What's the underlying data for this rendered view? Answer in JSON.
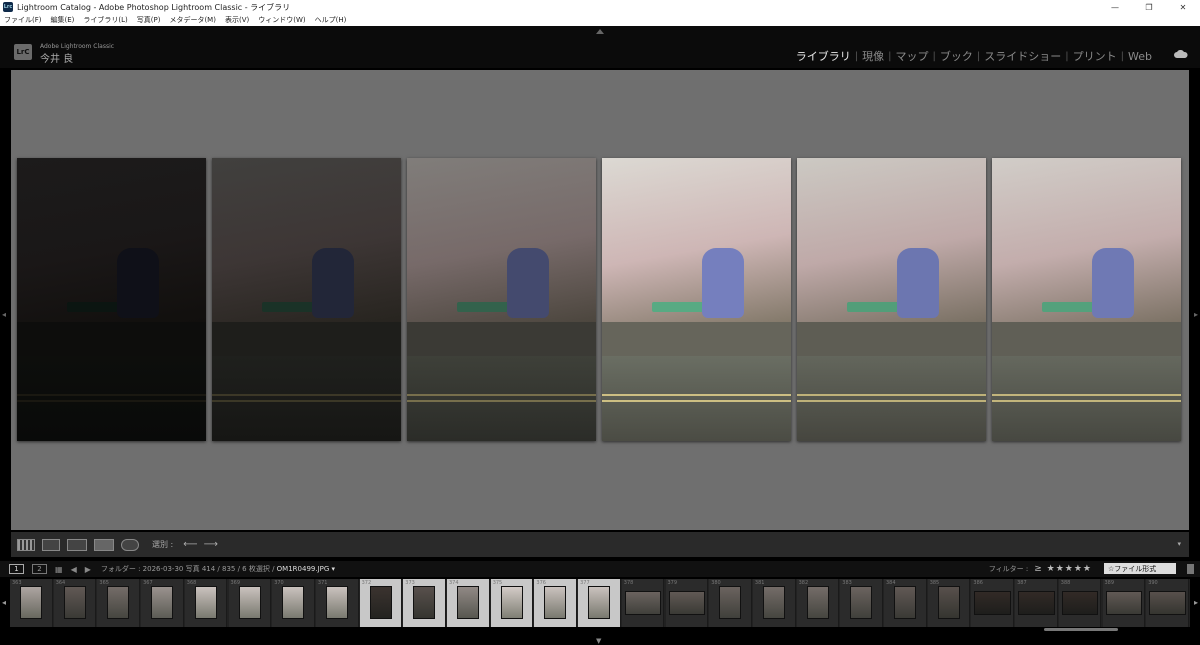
{
  "window": {
    "app_icon": "Lrc",
    "title": "Lightroom Catalog - Adobe Photoshop Lightroom Classic - ライブラリ",
    "controls": [
      "—",
      "❐",
      "✕"
    ]
  },
  "menu": [
    "ファイル(F)",
    "編集(E)",
    "ライブラリ(L)",
    "写真(P)",
    "メタデータ(M)",
    "表示(V)",
    "ウィンドウ(W)",
    "ヘルプ(H)"
  ],
  "identity": {
    "logo": "LrC",
    "product": "Adobe Lightroom Classic",
    "user": "今井 良"
  },
  "modules": [
    "ライブラリ",
    "現像",
    "マップ",
    "ブック",
    "スライドショー",
    "プリント",
    "Web"
  ],
  "active_module": "ライブラリ",
  "photos": [
    {
      "brightness": 0.12
    },
    {
      "brightness": 0.28
    },
    {
      "brightness": 0.55
    },
    {
      "brightness": 0.95
    },
    {
      "brightness": 0.88
    },
    {
      "brightness": 0.9
    }
  ],
  "toolbar": {
    "sort_label": "選別 :",
    "menu_icon": "chevron-down-icon"
  },
  "filmstrip_header": {
    "screens": [
      "1",
      "2"
    ],
    "folder": "フォルダー : 2026-03-30",
    "count": "写真 414 / 835 / 6 枚選択 /",
    "filename": "OM1R0499.JPG ▾",
    "filter_label": "フィルター :",
    "rating_filter": "≥ ★★★★★",
    "filter_select": "☆ファイル形式"
  },
  "filmstrip": [
    {
      "num": "363",
      "kind": "normal",
      "brightness": 0.7
    },
    {
      "num": "364",
      "kind": "normal",
      "brightness": 0.3
    },
    {
      "num": "365",
      "kind": "normal",
      "brightness": 0.4
    },
    {
      "num": "367",
      "kind": "normal",
      "brightness": 0.6
    },
    {
      "num": "368",
      "kind": "normal",
      "brightness": 0.85
    },
    {
      "num": "369",
      "kind": "normal",
      "brightness": 0.85
    },
    {
      "num": "370",
      "kind": "normal",
      "brightness": 0.85
    },
    {
      "num": "371",
      "kind": "normal",
      "brightness": 0.85
    },
    {
      "num": "372",
      "kind": "selected",
      "brightness": 0.1
    },
    {
      "num": "373",
      "kind": "selected",
      "brightness": 0.25
    },
    {
      "num": "374",
      "kind": "selected",
      "brightness": 0.55
    },
    {
      "num": "375",
      "kind": "selected",
      "brightness": 0.9
    },
    {
      "num": "376",
      "kind": "selected",
      "brightness": 0.85
    },
    {
      "num": "377",
      "kind": "selected",
      "brightness": 0.85
    },
    {
      "num": "378",
      "kind": "wide",
      "brightness": 0.35
    },
    {
      "num": "379",
      "kind": "wide",
      "brightness": 0.3
    },
    {
      "num": "380",
      "kind": "normal",
      "brightness": 0.35
    },
    {
      "num": "381",
      "kind": "normal",
      "brightness": 0.4
    },
    {
      "num": "382",
      "kind": "normal",
      "brightness": 0.4
    },
    {
      "num": "383",
      "kind": "normal",
      "brightness": 0.35
    },
    {
      "num": "384",
      "kind": "normal",
      "brightness": 0.3
    },
    {
      "num": "385",
      "kind": "normal",
      "brightness": 0.25
    },
    {
      "num": "386",
      "kind": "wide",
      "brightness": 0.05
    },
    {
      "num": "387",
      "kind": "wide",
      "brightness": 0.05
    },
    {
      "num": "388",
      "kind": "wide",
      "brightness": 0.05
    },
    {
      "num": "389",
      "kind": "wide",
      "brightness": 0.3
    },
    {
      "num": "390",
      "kind": "wide",
      "brightness": 0.25
    }
  ],
  "colors": {
    "accent": "#e8e8e8",
    "grid_bg": "#6f6f6f",
    "sakura": "#d9c0bf",
    "statue": "#7b86c8",
    "awning": "#5db38a"
  }
}
